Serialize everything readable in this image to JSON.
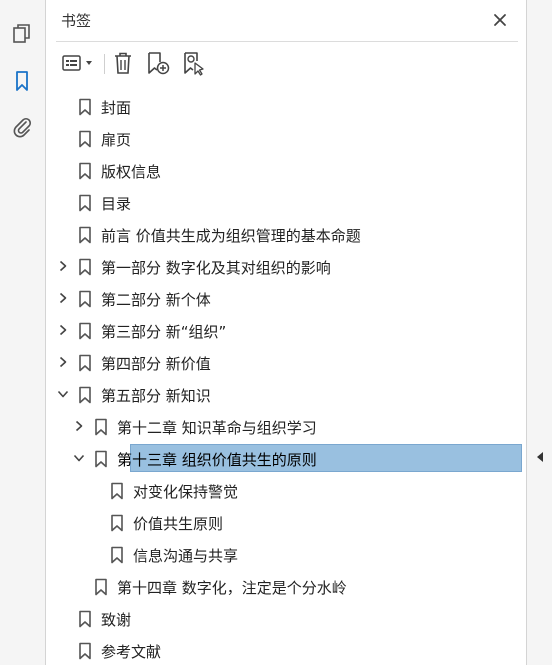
{
  "panel": {
    "title": "书签"
  },
  "left_rail": {
    "icons": [
      "pages-icon",
      "bookmark-icon",
      "attachment-icon"
    ]
  },
  "toolbar": {
    "icons": [
      "options-menu-icon",
      "delete-icon",
      "new-bookmark-icon",
      "bookmark-from-structure-icon"
    ]
  },
  "bookmarks": [
    {
      "label": "封面",
      "level": 0,
      "chevron": "none"
    },
    {
      "label": "扉页",
      "level": 0,
      "chevron": "none"
    },
    {
      "label": "版权信息",
      "level": 0,
      "chevron": "none"
    },
    {
      "label": "目录",
      "level": 0,
      "chevron": "none"
    },
    {
      "label": "前言 价值共生成为组织管理的基本命题",
      "level": 0,
      "chevron": "none"
    },
    {
      "label": "第一部分 数字化及其对组织的影响",
      "level": 0,
      "chevron": "right"
    },
    {
      "label": "第二部分 新个体",
      "level": 0,
      "chevron": "right"
    },
    {
      "label": "第三部分 新“组织”",
      "level": 0,
      "chevron": "right"
    },
    {
      "label": "第四部分 新价值",
      "level": 0,
      "chevron": "right"
    },
    {
      "label": "第五部分 新知识",
      "level": 0,
      "chevron": "down"
    },
    {
      "label": "第十二章 知识革命与组织学习",
      "level": 1,
      "chevron": "right"
    },
    {
      "label": "第十三章 组织价值共生的原则",
      "level": 1,
      "chevron": "down",
      "selected": true
    },
    {
      "label": "对变化保持警觉",
      "level": 2,
      "chevron": "none"
    },
    {
      "label": "价值共生原则",
      "level": 2,
      "chevron": "none"
    },
    {
      "label": "信息沟通与共享",
      "level": 2,
      "chevron": "none"
    },
    {
      "label": "第十四章 数字化，注定是个分水岭",
      "level": 1,
      "chevron": "none"
    },
    {
      "label": "致谢",
      "level": 0,
      "chevron": "none"
    },
    {
      "label": "参考文献",
      "level": 0,
      "chevron": "none"
    }
  ],
  "colors": {
    "selection": "#99c0e0",
    "accent": "#1a73c8"
  }
}
